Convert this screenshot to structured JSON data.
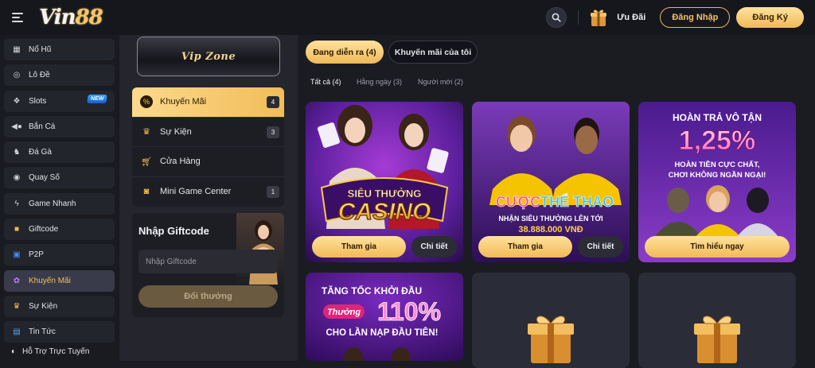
{
  "header": {
    "logo_main": "Vin",
    "logo_num": "88",
    "promo_label": "Ưu Đãi",
    "login_label": "Đăng Nhập",
    "register_label": "Đăng Ký"
  },
  "sidebar": {
    "items": [
      {
        "label": "Nổ Hũ",
        "icon": "slot-machine-icon"
      },
      {
        "label": "Lô Đề",
        "icon": "lottery-ball-icon"
      },
      {
        "label": "Slots",
        "icon": "slots-icon",
        "badge": "NEW"
      },
      {
        "label": "Bắn Cá",
        "icon": "fish-icon"
      },
      {
        "label": "Đá Gà",
        "icon": "rooster-icon"
      },
      {
        "label": "Quay Số",
        "icon": "lottery-wheel-icon"
      },
      {
        "label": "Game Nhanh",
        "icon": "lightning-icon"
      },
      {
        "label": "Giftcode",
        "icon": "gift-icon"
      },
      {
        "label": "P2P",
        "icon": "p2p-icon"
      },
      {
        "label": "Khuyến Mãi",
        "icon": "promotion-icon",
        "active": true
      },
      {
        "label": "Sự Kiện",
        "icon": "trophy-icon"
      },
      {
        "label": "Tin Tức",
        "icon": "news-icon"
      }
    ],
    "footer_label": "Hỗ Trợ Trực Tuyến"
  },
  "midpanel": {
    "vip_label": "Vip Zone",
    "menu": [
      {
        "label": "Khuyến Mãi",
        "count": "4",
        "active": true
      },
      {
        "label": "Sự Kiện",
        "count": "3"
      },
      {
        "label": "Cửa Hàng",
        "count": ""
      },
      {
        "label": "Mini Game Center",
        "count": "1"
      }
    ],
    "giftcode": {
      "title": "Nhập Giftcode",
      "placeholder": "Nhập Giftcode",
      "button": "Đổi thưởng"
    }
  },
  "content": {
    "tabs": [
      {
        "label": "Đang diễn ra (4)",
        "active": true
      },
      {
        "label": "Khuyến mãi của tôi",
        "active": false
      }
    ],
    "subtabs": [
      {
        "label": "Tất cả (4)",
        "active": true
      },
      {
        "label": "Hằng ngày (3)",
        "active": false
      },
      {
        "label": "Người mới (2)",
        "active": false
      }
    ],
    "cards": [
      {
        "banner_line1": "SIÊU THƯỞNG",
        "banner_line2": "CASINO",
        "btn_primary": "Tham gia",
        "btn_secondary": "Chi tiết"
      },
      {
        "banner_line1": "CƯỢC",
        "banner_line2": "THỂ THAO",
        "banner_line3": "NHẬN SIÊU THƯỞNG LÊN TỚI",
        "banner_line4": "38.888.000 VNĐ",
        "btn_primary": "Tham gia",
        "btn_secondary": "Chi tiết"
      },
      {
        "banner_line1": "HOÀN TRẢ VÔ TẬN",
        "banner_line2": "1,25%",
        "banner_line3": "HOÀN TIỀN CỰC CHẤT,",
        "banner_line4": "CHƠI KHÔNG NGẦN NGẠI!",
        "btn_primary": "Tìm hiểu ngay"
      },
      {
        "banner_line1": "TĂNG TỐC KHỞI ĐẦU",
        "banner_line2": "Thưởng",
        "banner_line3": "110%",
        "banner_line4": "CHO LẦN NẠP ĐẦU TIÊN!"
      }
    ]
  },
  "colors": {
    "accent_gold": "#f0b955",
    "bg_dark": "#1b1c22",
    "panel": "#24252d",
    "purple_banner": "#5b1f9c"
  }
}
